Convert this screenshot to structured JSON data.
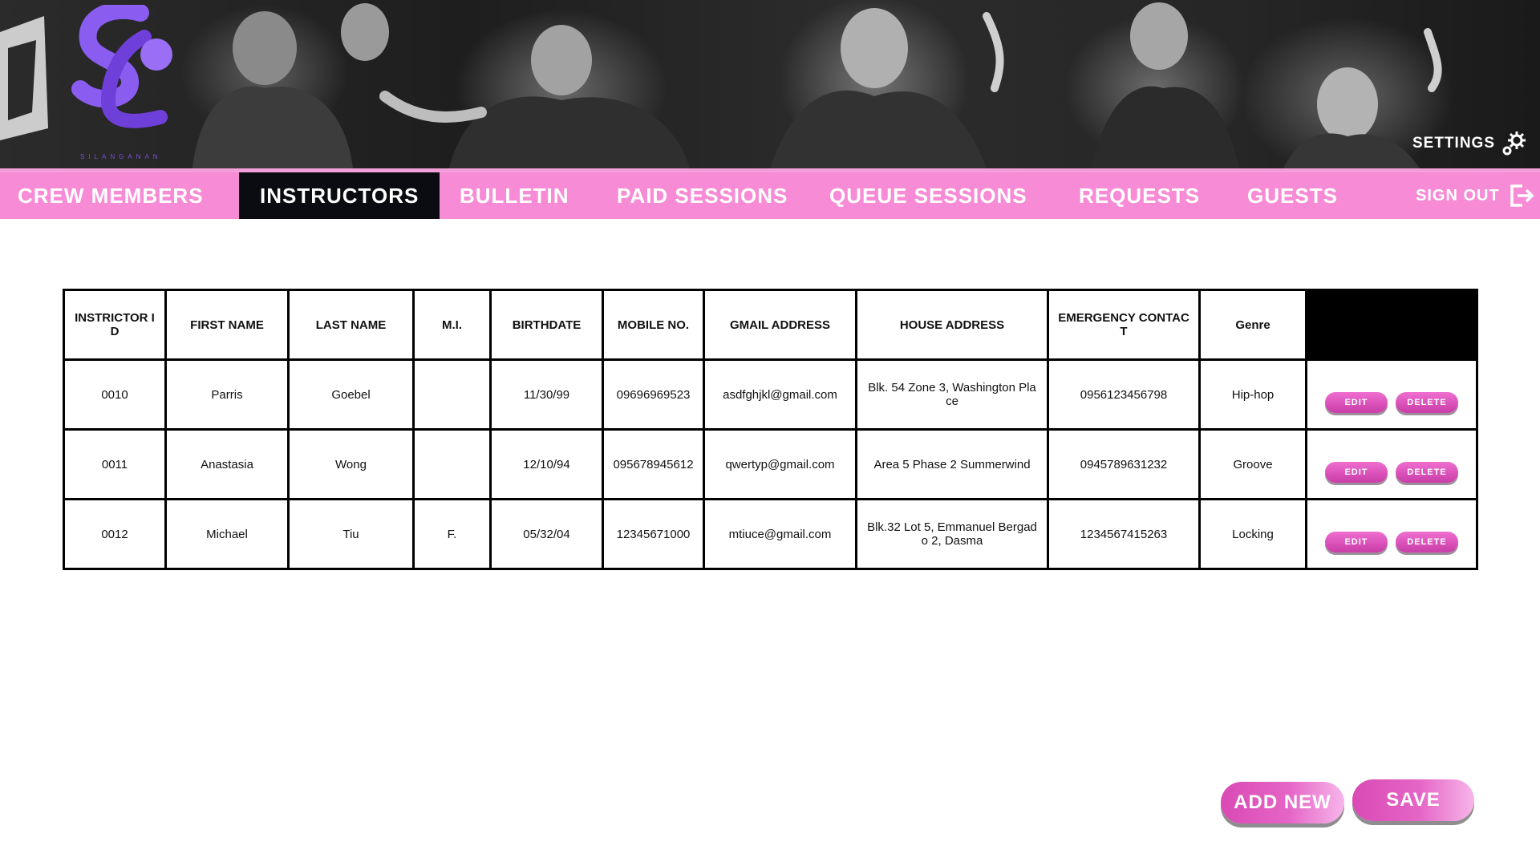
{
  "brand": {
    "sub_label": "SILANGANAN",
    "accent": "#8a5cf0"
  },
  "header": {
    "settings_label": "SETTINGS"
  },
  "nav": {
    "items": [
      {
        "label": "CREW MEMBERS"
      },
      {
        "label": "INSTRUCTORS",
        "active": true
      },
      {
        "label": "BULLETIN"
      },
      {
        "label": "PAID SESSIONS"
      },
      {
        "label": "QUEUE SESSIONS"
      },
      {
        "label": "REQUESTS"
      },
      {
        "label": "GUESTS"
      }
    ],
    "sign_out": "SIGN OUT",
    "bar_color": "#f78bd6",
    "active_color": "#0b0b12"
  },
  "table": {
    "headers": [
      "INSTRICTOR ID",
      "FIRST NAME",
      "LAST NAME",
      "M.I.",
      "BIRTHDATE",
      "MOBILE NO.",
      "GMAIL ADDRESS",
      "HOUSE ADDRESS",
      "EMERGENCY CONTACT",
      "Genre"
    ],
    "rows": [
      [
        "0010",
        "Parris",
        "Goebel",
        "",
        "11/30/99",
        "09696969523",
        "asdfghjkl@gmail.com",
        "Blk. 54 Zone 3, Washington Place",
        "0956123456798",
        "Hip-hop"
      ],
      [
        "0011",
        "Anastasia",
        "Wong",
        "",
        "12/10/94",
        "095678945612",
        "qwertyp@gmail.com",
        "Area 5 Phase 2 Summerwind",
        "0945789631232",
        "Groove"
      ],
      [
        "0012",
        "Michael",
        "Tiu",
        "F.",
        "05/32/04",
        "12345671000",
        "mtiuce@gmail.com",
        "Blk.32 Lot 5, Emmanuel Bergado 2, Dasma",
        "1234567415263",
        "Locking"
      ]
    ],
    "edit_label": "EDIT",
    "delete_label": "DELETE"
  },
  "actions": {
    "add_new": "ADD NEW",
    "save": "SAVE"
  }
}
